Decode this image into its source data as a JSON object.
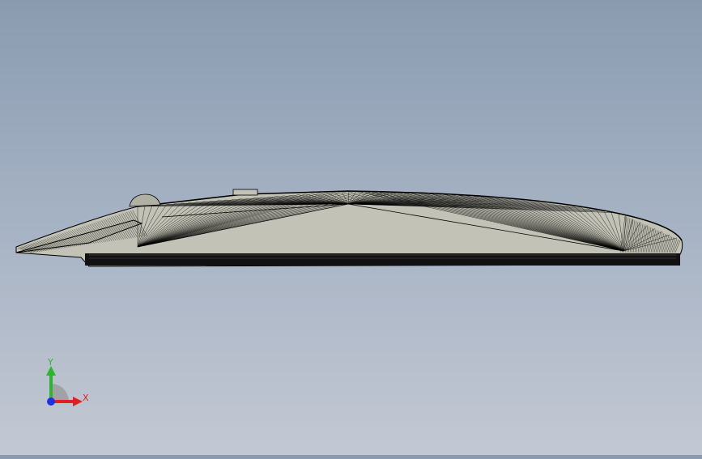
{
  "viewport": {
    "model": "side-profile-wireframe-part",
    "mesh_fill": "#c2c2b6",
    "edge_color": "#000000"
  },
  "triad": {
    "x_label": "X",
    "y_label": "Y",
    "x_color": "#e02020",
    "y_color": "#2db52d",
    "z_color": "#2030e0"
  }
}
